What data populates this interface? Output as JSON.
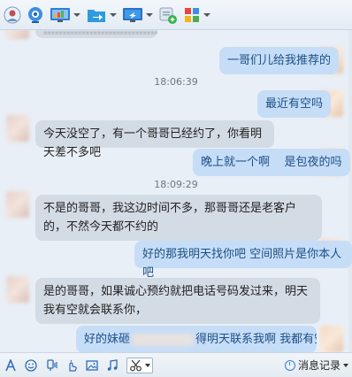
{
  "toolbar": {
    "icons": [
      "avatar-icon",
      "camera-icon",
      "screen-share-icon",
      "file-transfer-icon",
      "remote-desktop-icon",
      "add-app-icon",
      "apps-grid-icon"
    ]
  },
  "chat": {
    "top_partial_text": "…………………………",
    "timestamps": [
      "18:06:39",
      "18:09:29"
    ],
    "messages": [
      {
        "from": "me",
        "text": "一哥们儿给我推荐的"
      },
      {
        "from": "me",
        "text": "最近有空吗"
      },
      {
        "from": "them",
        "text": "今天没空了，有一个哥哥已经约了，你看明天差不多吧"
      },
      {
        "from": "me",
        "text": "晚上就一个啊    是包夜的吗"
      },
      {
        "from": "them",
        "text": "不是的哥哥，我这边时间不多，那哥哥还是老客户的，不然今天都不约的"
      },
      {
        "from": "me",
        "text": "好的那我明天找你吧 空间照片是你本人吧"
      },
      {
        "from": "them",
        "text": "是的哥哥，如果诚心预约就把电话号码发过来，明天我有空就会联系你，"
      },
      {
        "from": "me",
        "text_start": "好的妹砸",
        "text_end": "得明天联系我啊 我都有空的"
      }
    ]
  },
  "bottombar": {
    "icons": [
      "font-icon",
      "emoji-icon",
      "voice-icon",
      "poke-icon",
      "image-icon",
      "music-icon",
      "screenshot-icon"
    ],
    "history_label": "消息记录"
  },
  "colors": {
    "incoming_bubble": "#d3dbe5",
    "outgoing_bubble": "#c6ddf7",
    "outgoing_text": "#1c4f86"
  }
}
